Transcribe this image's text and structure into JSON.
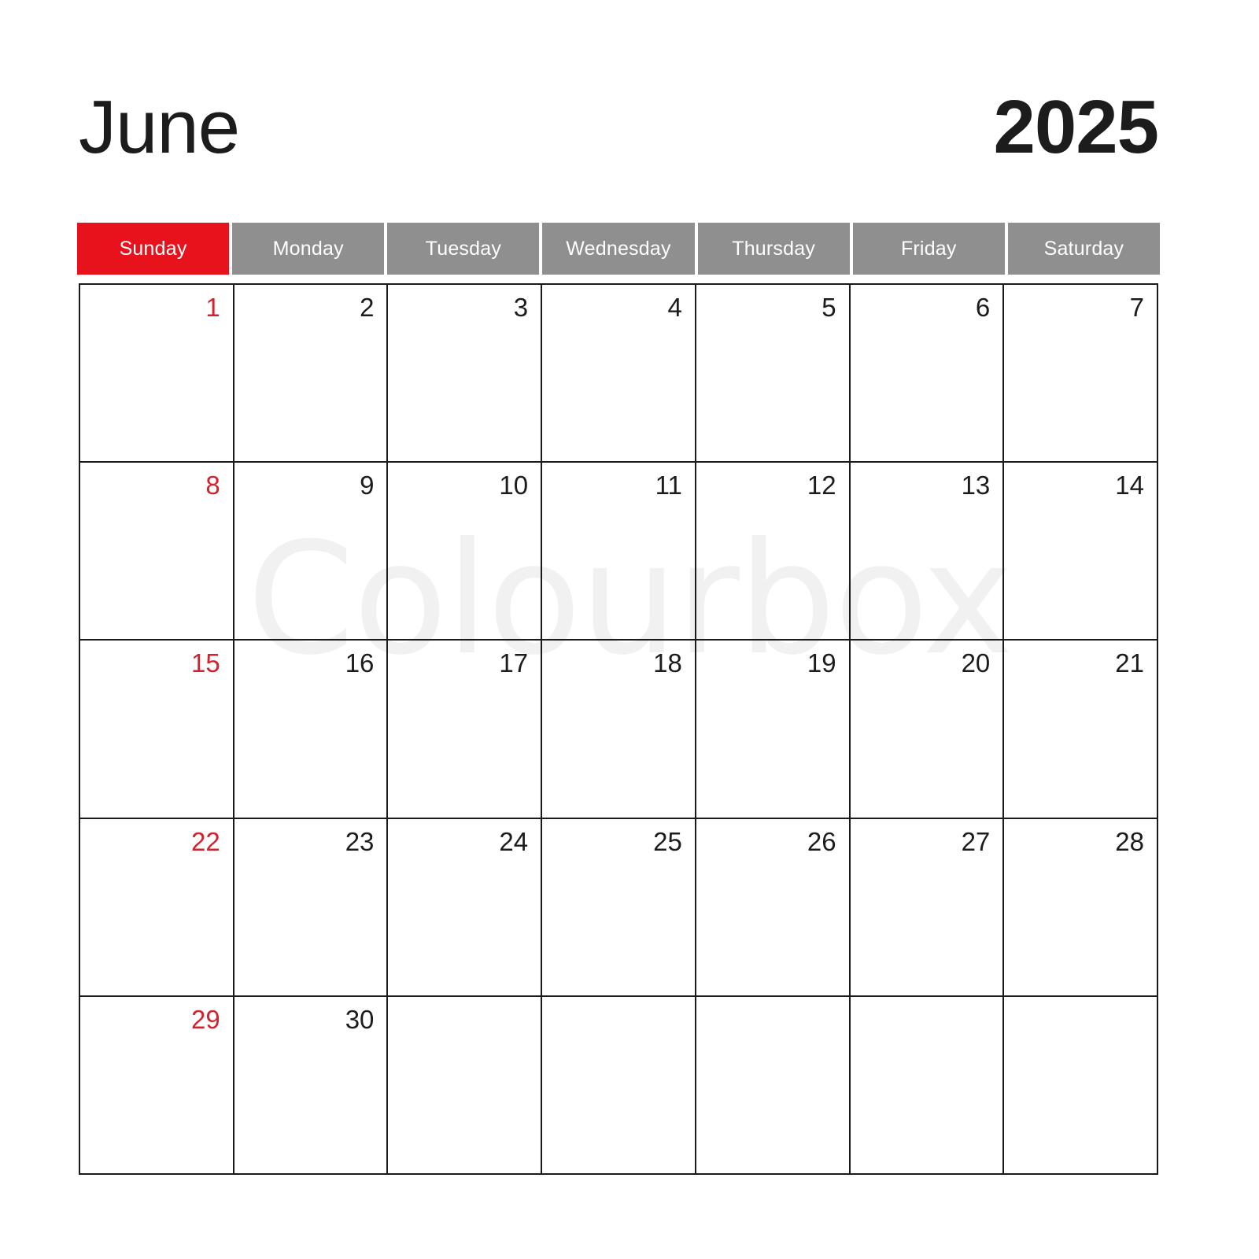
{
  "watermark": {
    "text": "Colourbox"
  },
  "header": {
    "month": "June",
    "year": "2025"
  },
  "colors": {
    "sunday_header_bg": "#e8121d",
    "weekday_header_bg": "#8f8f8f",
    "header_text": "#ffffff",
    "sunday_number": "#d2222d",
    "weekday_number": "#1c1c1c",
    "grid_line": "#1a1a1a",
    "page_bg": "#ffffff",
    "watermark": "#f1f1f1"
  },
  "weekdays": [
    {
      "label": "Sunday",
      "highlight": true
    },
    {
      "label": "Monday",
      "highlight": false
    },
    {
      "label": "Tuesday",
      "highlight": false
    },
    {
      "label": "Wednesday",
      "highlight": false
    },
    {
      "label": "Thursday",
      "highlight": false
    },
    {
      "label": "Friday",
      "highlight": false
    },
    {
      "label": "Saturday",
      "highlight": false
    }
  ],
  "calendar": {
    "first_day_of_week": "Sunday",
    "days_in_month": 30,
    "weeks": [
      [
        {
          "day": "1",
          "sunday": true
        },
        {
          "day": "2",
          "sunday": false
        },
        {
          "day": "3",
          "sunday": false
        },
        {
          "day": "4",
          "sunday": false
        },
        {
          "day": "5",
          "sunday": false
        },
        {
          "day": "6",
          "sunday": false
        },
        {
          "day": "7",
          "sunday": false
        }
      ],
      [
        {
          "day": "8",
          "sunday": true
        },
        {
          "day": "9",
          "sunday": false
        },
        {
          "day": "10",
          "sunday": false
        },
        {
          "day": "11",
          "sunday": false
        },
        {
          "day": "12",
          "sunday": false
        },
        {
          "day": "13",
          "sunday": false
        },
        {
          "day": "14",
          "sunday": false
        }
      ],
      [
        {
          "day": "15",
          "sunday": true
        },
        {
          "day": "16",
          "sunday": false
        },
        {
          "day": "17",
          "sunday": false
        },
        {
          "day": "18",
          "sunday": false
        },
        {
          "day": "19",
          "sunday": false
        },
        {
          "day": "20",
          "sunday": false
        },
        {
          "day": "21",
          "sunday": false
        }
      ],
      [
        {
          "day": "22",
          "sunday": true
        },
        {
          "day": "23",
          "sunday": false
        },
        {
          "day": "24",
          "sunday": false
        },
        {
          "day": "25",
          "sunday": false
        },
        {
          "day": "26",
          "sunday": false
        },
        {
          "day": "27",
          "sunday": false
        },
        {
          "day": "28",
          "sunday": false
        }
      ],
      [
        {
          "day": "29",
          "sunday": true
        },
        {
          "day": "30",
          "sunday": false
        },
        {
          "day": "",
          "sunday": false
        },
        {
          "day": "",
          "sunday": false
        },
        {
          "day": "",
          "sunday": false
        },
        {
          "day": "",
          "sunday": false
        },
        {
          "day": "",
          "sunday": false
        }
      ]
    ]
  }
}
